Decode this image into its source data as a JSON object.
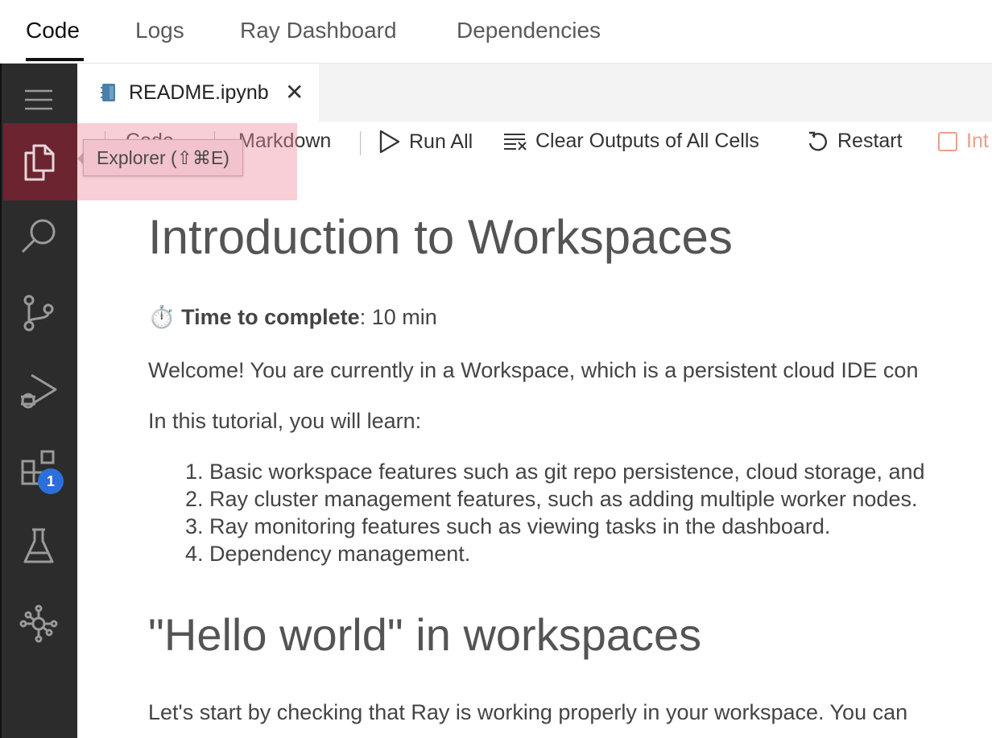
{
  "top_tabs": [
    {
      "label": "Code",
      "active": true
    },
    {
      "label": "Logs",
      "active": false
    },
    {
      "label": "Ray Dashboard",
      "active": false
    },
    {
      "label": "Dependencies",
      "active": false
    }
  ],
  "activity_bar": {
    "items": [
      {
        "icon": "menu-icon"
      },
      {
        "icon": "files-icon",
        "active": true
      },
      {
        "icon": "search-icon"
      },
      {
        "icon": "source-control-icon"
      },
      {
        "icon": "run-debug-icon"
      },
      {
        "icon": "extensions-icon",
        "badge": "1"
      },
      {
        "icon": "flask-icon"
      },
      {
        "icon": "ray-graph-icon"
      }
    ],
    "extensions_badge": "1"
  },
  "tooltip": {
    "text": "Explorer (⇧⌘E)"
  },
  "editor_tab": {
    "label": "README.ipynb",
    "close": "✕",
    "icon": "notebook-icon"
  },
  "toolbar": {
    "code_label": "Code",
    "markdown_label": "Markdown",
    "run_all_label": "Run All",
    "clear_outputs_label": "Clear Outputs of All Cells",
    "restart_label": "Restart",
    "interrupt_label": "Int"
  },
  "document": {
    "title": "Introduction to Workspaces",
    "time_emoji": "⏱️",
    "time_label": "Time to complete",
    "time_value": ": 10 min",
    "welcome": "Welcome! You are currently in a Workspace, which is a persistent cloud IDE con",
    "learn_intro": "In this tutorial, you will learn:",
    "learn_items": [
      "1. Basic workspace features such as git repo persistence, cloud storage, and",
      "2. Ray cluster management features, such as adding multiple worker nodes.",
      "3. Ray monitoring features such as viewing tasks in the dashboard.",
      "4. Dependency management."
    ],
    "section_title": "\"Hello world\" in workspaces",
    "section_text": "Let's start by checking that Ray is working properly in your workspace. You can"
  }
}
